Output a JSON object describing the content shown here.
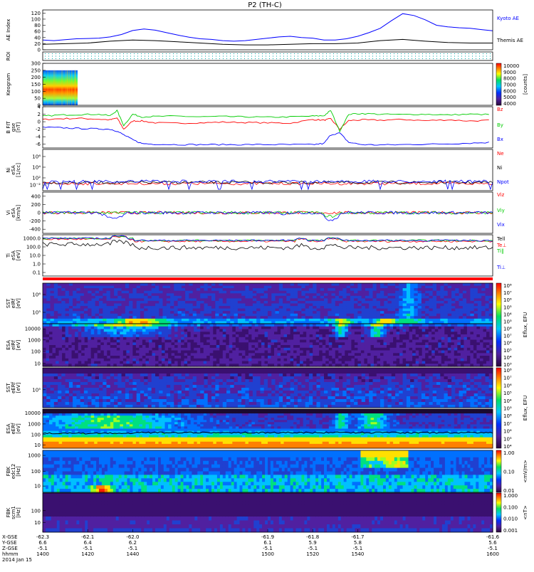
{
  "title": "P2 (TH-C)",
  "colors": {
    "blue": "#0000ff",
    "red": "#ff0000",
    "green": "#00cc00",
    "black": "#000000"
  },
  "chart_data": [
    {
      "type": "line",
      "panel": "ae",
      "ylabel": "AE Index",
      "ylim": [
        0,
        130
      ],
      "yticks": [
        "120",
        "100",
        "80",
        "60",
        "40",
        "20",
        "0"
      ],
      "series": [
        {
          "name": "Kyoto AE",
          "color": "#0000ff",
          "x": [
            1400,
            1405,
            1410,
            1415,
            1420,
            1425,
            1430,
            1435,
            1440,
            1445,
            1450,
            1455,
            1460,
            1465,
            1470,
            1475,
            1480,
            1485,
            1490,
            1495,
            1500,
            1505,
            1510,
            1515,
            1520,
            1525,
            1530,
            1535,
            1540,
            1545,
            1550,
            1555,
            1560,
            1565,
            1570,
            1575,
            1580,
            1585,
            1590,
            1595,
            1600
          ],
          "y": [
            32,
            30,
            33,
            36,
            37,
            38,
            42,
            50,
            63,
            68,
            64,
            56,
            48,
            41,
            36,
            34,
            30,
            28,
            30,
            34,
            38,
            42,
            44,
            40,
            38,
            32,
            32,
            36,
            44,
            56,
            70,
            95,
            118,
            112,
            98,
            80,
            75,
            72,
            70,
            66,
            62
          ]
        },
        {
          "name": "Themis AE",
          "color": "#000000",
          "x": [
            1400,
            1410,
            1420,
            1430,
            1440,
            1450,
            1460,
            1470,
            1480,
            1490,
            1500,
            1510,
            1520,
            1530,
            1540,
            1550,
            1560,
            1570,
            1580,
            1590,
            1600
          ],
          "y": [
            18,
            20,
            22,
            28,
            32,
            30,
            26,
            22,
            18,
            16,
            16,
            18,
            20,
            20,
            22,
            30,
            34,
            28,
            24,
            22,
            22
          ]
        }
      ]
    },
    {
      "type": "heatmap",
      "panel": "roi",
      "ylabel": "ROI",
      "yticks": []
    },
    {
      "type": "heatmap",
      "panel": "keogram",
      "ylabel": "Keogram",
      "yticks": [
        "300",
        "250",
        "200",
        "150",
        "100",
        "50",
        "0"
      ],
      "colorbar": {
        "label": "[counts]",
        "ticks": [
          "10000",
          "9000",
          "8000",
          "7000",
          "6000",
          "5000",
          "4000"
        ]
      }
    },
    {
      "type": "line",
      "panel": "bfield",
      "ylabel": "B FIT",
      "units": "[nT]",
      "subl": "gse",
      "ylim": [
        -7,
        4
      ],
      "yticks": [
        "4",
        "2",
        "0",
        "-2",
        "-4",
        "-6"
      ],
      "series": [
        {
          "name": "Bz",
          "color": "#ff0000",
          "x": [
            1400,
            1408,
            1416,
            1424,
            1430,
            1433,
            1436,
            1440,
            1444,
            1450,
            1460,
            1470,
            1480,
            1490,
            1500,
            1510,
            1520,
            1525,
            1528,
            1532,
            1536,
            1542,
            1550,
            1560,
            1570,
            1580,
            1590,
            1600
          ],
          "y": [
            0.6,
            0.8,
            0.9,
            0.7,
            0.5,
            1.0,
            -2.0,
            0.2,
            0.2,
            -0.3,
            -0.4,
            -0.3,
            -0.1,
            -0.2,
            -0.3,
            -0.4,
            0.6,
            0.4,
            0.8,
            -2.0,
            0.3,
            0.5,
            0.4,
            0.6,
            0.3,
            0.5,
            0.2,
            0.4
          ]
        },
        {
          "name": "By",
          "color": "#00cc00",
          "x": [
            1400,
            1408,
            1416,
            1424,
            1430,
            1433,
            1436,
            1440,
            1444,
            1450,
            1460,
            1470,
            1480,
            1490,
            1500,
            1510,
            1520,
            1525,
            1528,
            1532,
            1536,
            1542,
            1550,
            1560,
            1570,
            1580,
            1590,
            1600
          ],
          "y": [
            1.5,
            1.8,
            1.9,
            2.0,
            1.6,
            3.0,
            -1.0,
            2.0,
            1.3,
            1.4,
            1.5,
            1.3,
            1.4,
            1.3,
            1.2,
            1.3,
            1.5,
            1.6,
            3.0,
            -2.5,
            2.0,
            2.2,
            2.0,
            1.9,
            2.0,
            1.8,
            2.0,
            1.9
          ]
        },
        {
          "name": "Bx",
          "color": "#0000ff",
          "x": [
            1400,
            1408,
            1416,
            1424,
            1430,
            1433,
            1436,
            1440,
            1444,
            1450,
            1460,
            1470,
            1480,
            1490,
            1500,
            1510,
            1520,
            1525,
            1528,
            1532,
            1536,
            1542,
            1550,
            1560,
            1570,
            1580,
            1590,
            1600
          ],
          "y": [
            -1.5,
            -1.6,
            -1.8,
            -1.9,
            -2.0,
            -2.5,
            -3.5,
            -4.8,
            -5.8,
            -6.0,
            -6.1,
            -6.1,
            -6.1,
            -6.1,
            -6.1,
            -6.1,
            -6.1,
            -5.8,
            -3.5,
            -3.0,
            -5.5,
            -6.1,
            -6.2,
            -6.1,
            -6.0,
            -5.9,
            -5.7,
            -5.5
          ]
        }
      ]
    },
    {
      "type": "line",
      "panel": "density",
      "ylabel": "Ni",
      "units": "[1/cc]",
      "subl": "eSA",
      "yticks": [
        "10⁶",
        "10⁴",
        "10²",
        "10⁻²"
      ],
      "series": [
        {
          "name": "Ne",
          "color": "#ff0000"
        },
        {
          "name": "Ni",
          "color": "#000000"
        },
        {
          "name": "Npot",
          "color": "#0000ff"
        }
      ]
    },
    {
      "type": "line",
      "panel": "velocity",
      "ylabel": "Vi",
      "units": "[km/s]",
      "subl": "eSA",
      "ylim": [
        -500,
        500
      ],
      "yticks": [
        "400",
        "200",
        "0",
        "-200",
        "-400"
      ],
      "series": [
        {
          "name": "Viz",
          "color": "#ff0000"
        },
        {
          "name": "Viy",
          "color": "#00cc00"
        },
        {
          "name": "Vix",
          "color": "#0000ff"
        }
      ]
    },
    {
      "type": "line",
      "panel": "temperature",
      "ylabel": "Ti",
      "units": "[eV]",
      "subl": "eSA",
      "yticks": [
        "1000.0",
        "100.0",
        "10.0",
        "1.0",
        "0.1"
      ],
      "series": [
        {
          "name": "Tell",
          "color": "#000000"
        },
        {
          "name": "Te⊥",
          "color": "#ff0000"
        },
        {
          "name": "Ti‖",
          "color": "#00cc00"
        },
        {
          "name": "Ti⊥",
          "color": "#0000ff"
        }
      ]
    },
    {
      "type": "heatmap",
      "panel": "sst_i",
      "ylabel": "SST",
      "units": "[eV]",
      "subl": "eIRf",
      "yticks": [
        "10⁶",
        "10⁵"
      ]
    },
    {
      "type": "heatmap",
      "panel": "esa_i",
      "ylabel": "ESA",
      "units": "[eV]",
      "subl": "eIRf",
      "yticks": [
        "10000",
        "1000",
        "100",
        "10"
      ],
      "colorbar": {
        "label": "Eflux, EFU",
        "ticks": [
          "10⁸",
          "10⁷",
          "10⁶",
          "10⁵",
          "10⁴",
          "10³",
          "10⁸",
          "10⁷",
          "10⁶",
          "10⁵",
          "10⁴",
          "10³"
        ]
      }
    },
    {
      "type": "heatmap",
      "panel": "sst_e",
      "ylabel": "SST",
      "units": "[eV]",
      "subl": "eERf",
      "yticks": [
        "10⁵"
      ]
    },
    {
      "type": "heatmap",
      "panel": "esa_e",
      "ylabel": "ESA",
      "units": "[eV]",
      "subl": "eERf",
      "yticks": [
        "10000",
        "1000",
        "100",
        "10"
      ],
      "colorbar": {
        "label": "Eflux, EFU",
        "ticks": [
          "10⁸",
          "10⁷",
          "10⁶",
          "10⁵",
          "10⁴",
          "10³",
          "10⁸",
          "10⁷",
          "10⁶",
          "10⁵",
          "10⁴"
        ]
      }
    },
    {
      "type": "heatmap",
      "panel": "fbk_e",
      "ylabel": "FBK",
      "units": "[Hz]",
      "subl": "edc12",
      "yticks": [
        "1000",
        "100",
        "10"
      ],
      "colorbar": {
        "label": "<mV/m>",
        "ticks": [
          "1.00",
          "0.10",
          "0.01"
        ]
      }
    },
    {
      "type": "heatmap",
      "panel": "fbk_b",
      "ylabel": "FBK",
      "units": "[Hz]",
      "subl": "scm1",
      "yticks": [
        "100",
        "10"
      ],
      "colorbar": {
        "label": "<nT>",
        "ticks": [
          "1.000",
          "0.100",
          "0.010",
          "0.001"
        ]
      }
    }
  ],
  "xaxis": {
    "rows": [
      "X-GSE",
      "Y-GSE",
      "Z-GSE",
      "hhmm"
    ],
    "date": "2014 Jan 15",
    "ticks": [
      {
        "x": "-62.3",
        "y": "6.6",
        "z": "-5.1",
        "t": "1400"
      },
      {
        "x": "-62.1",
        "y": "6.4",
        "z": "-5.1",
        "t": "1420"
      },
      {
        "x": "-62.0",
        "y": "6.2",
        "z": "-5.1",
        "t": "1440"
      },
      {
        "x": "-61.9",
        "y": "6.1",
        "z": "-5.1",
        "t": "1500"
      },
      {
        "x": "-61.8",
        "y": "5.9",
        "z": "-5.1",
        "t": "1520"
      },
      {
        "x": "-61.7",
        "y": "5.8",
        "z": "-5.1",
        "t": "1540"
      },
      {
        "x": "-61.6",
        "y": "5.6",
        "z": "-5.1",
        "t": "1600"
      }
    ]
  }
}
